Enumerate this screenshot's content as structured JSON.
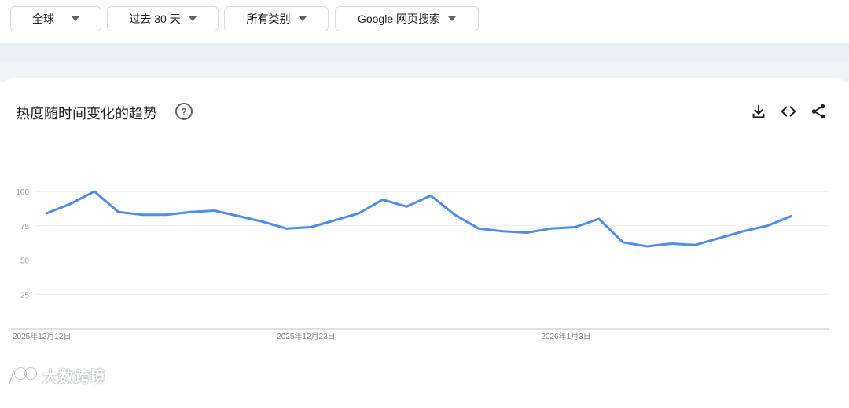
{
  "filters": {
    "region": "全球",
    "time": "过去 30 天",
    "category": "所有类别",
    "search_type": "Google 网页搜索"
  },
  "card": {
    "title": "热度随时间变化的趋势",
    "help_icon": "?"
  },
  "toolbar": {
    "icons": [
      "download-icon",
      "embed-icon",
      "share-icon"
    ]
  },
  "watermark": {
    "text": "大数跨境"
  },
  "chart_data": {
    "type": "line",
    "title": "",
    "xlabel": "",
    "ylabel": "",
    "ylim": [
      0,
      100
    ],
    "yticks": [
      25,
      50,
      75,
      100
    ],
    "grid": true,
    "line_color": "#4e8ee8",
    "x_tick_labels": [
      {
        "label": "2025年12月12日",
        "index": 0
      },
      {
        "label": "2025年12月23日",
        "index": 11
      },
      {
        "label": "2026年1月3日",
        "index": 22
      }
    ],
    "x": [
      "2025-12-12",
      "2025-12-13",
      "2025-12-14",
      "2025-12-15",
      "2025-12-16",
      "2025-12-17",
      "2025-12-18",
      "2025-12-19",
      "2025-12-20",
      "2025-12-21",
      "2025-12-22",
      "2025-12-23",
      "2025-12-24",
      "2025-12-25",
      "2025-12-26",
      "2025-12-27",
      "2025-12-28",
      "2025-12-29",
      "2025-12-30",
      "2025-12-31",
      "2026-01-01",
      "2026-01-02",
      "2026-01-03",
      "2026-01-04",
      "2026-01-05",
      "2026-01-06",
      "2026-01-07",
      "2026-01-08",
      "2026-01-09",
      "2026-01-10",
      "2026-01-11",
      "2026-01-12",
      "2026-01-13"
    ],
    "series": [
      {
        "values": [
          84,
          91,
          100,
          85,
          83,
          83,
          85,
          86,
          82,
          78,
          73,
          74,
          79,
          84,
          94,
          89,
          97,
          83,
          73,
          71,
          70,
          73,
          74,
          80,
          63,
          60,
          62,
          61,
          66,
          71,
          75,
          82
        ]
      }
    ]
  }
}
